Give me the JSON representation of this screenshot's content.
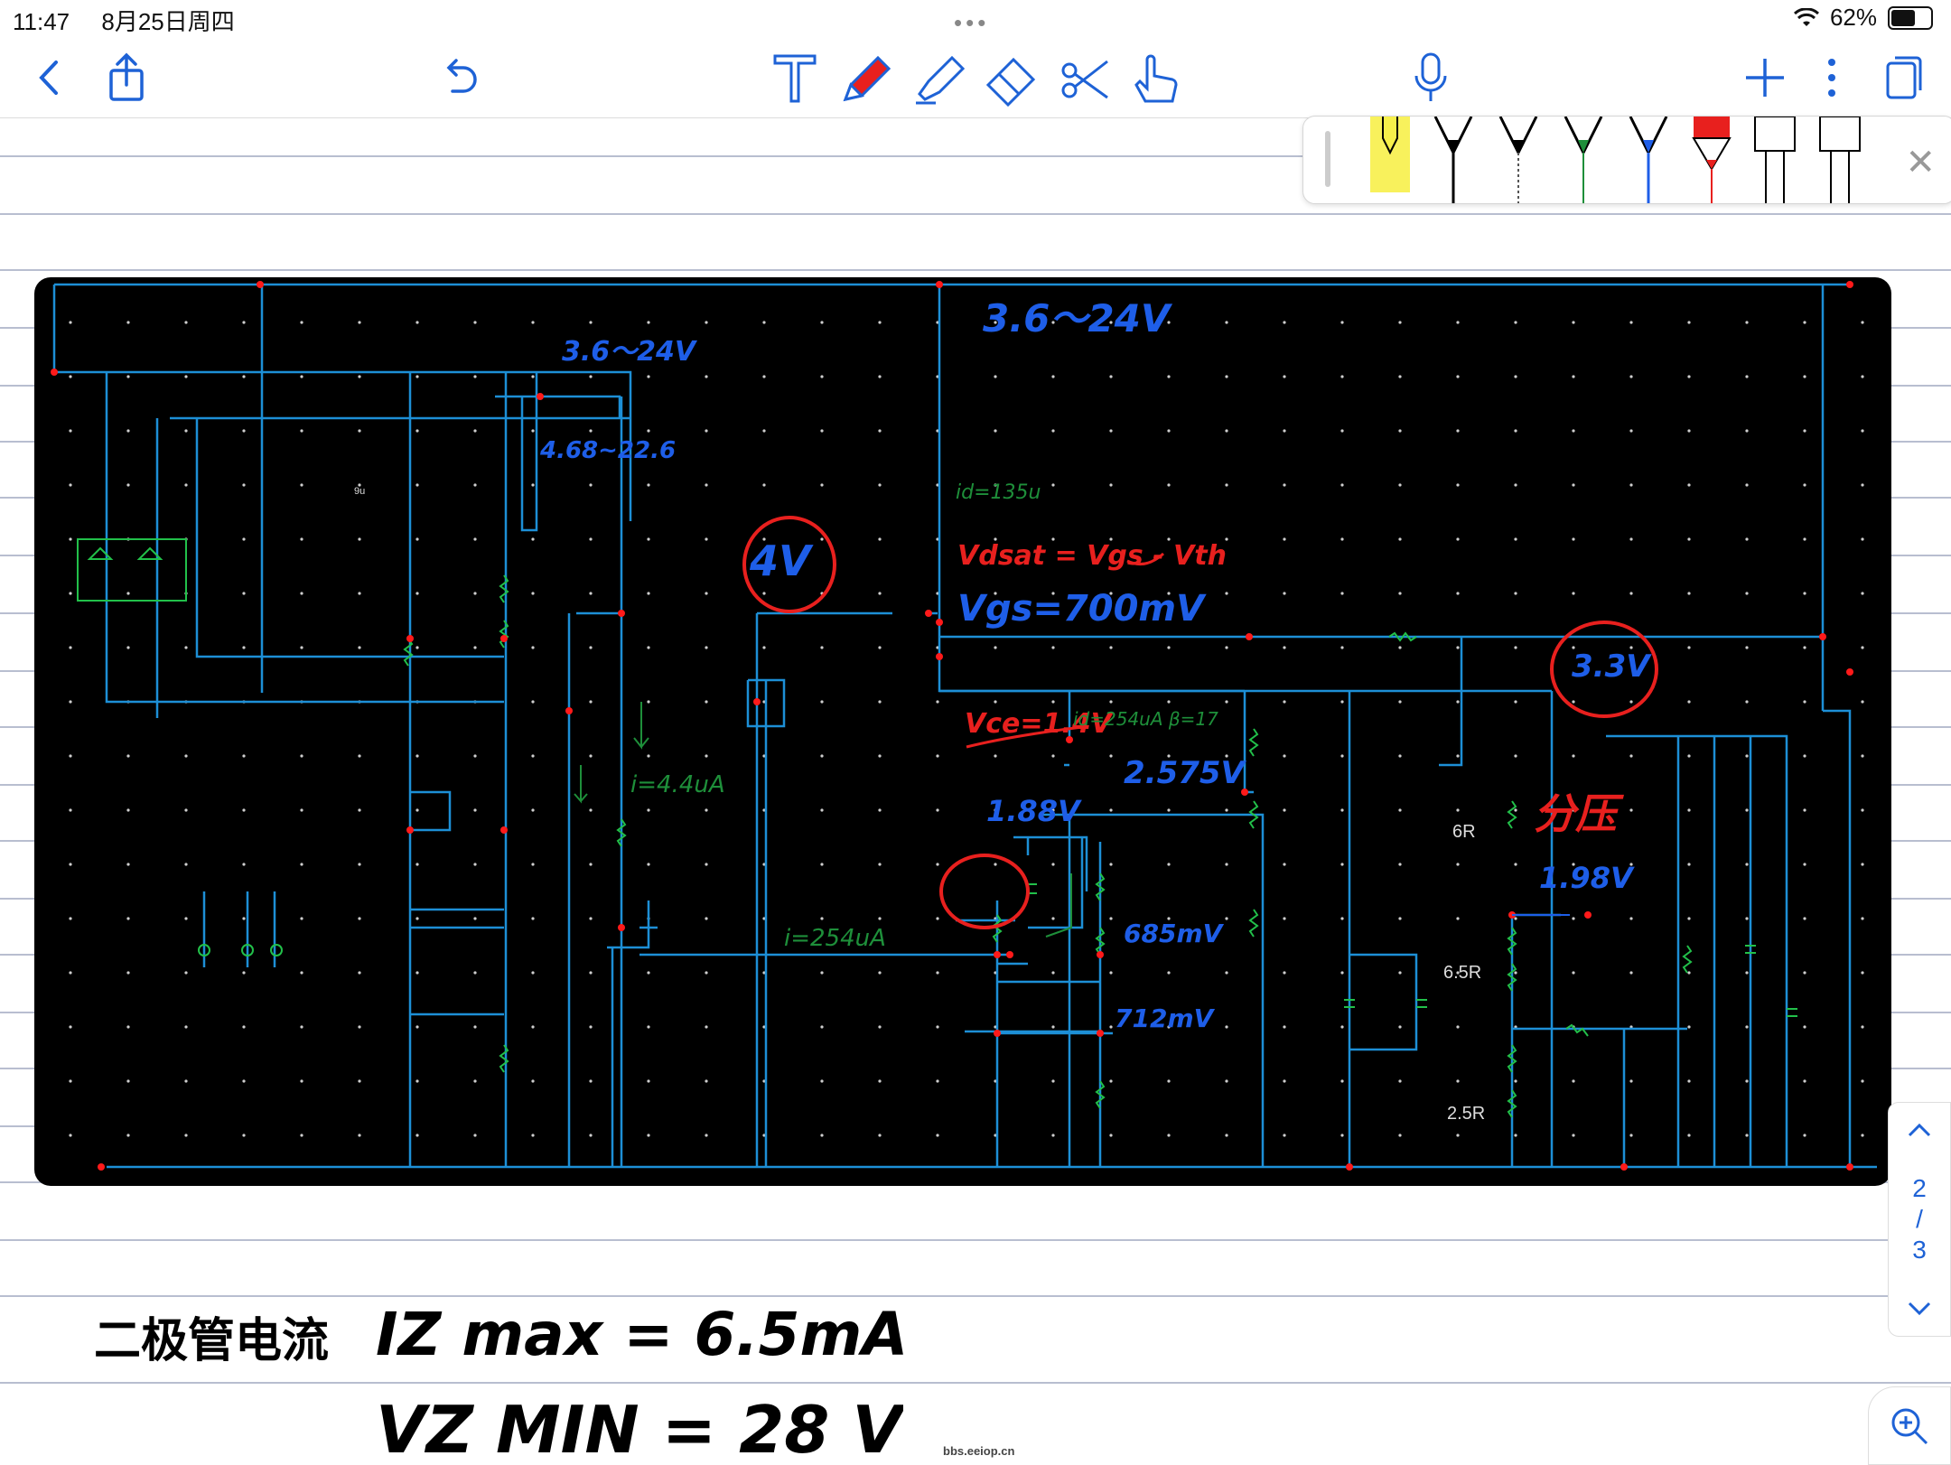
{
  "status": {
    "time": "11:47",
    "date": "8月25日周四",
    "dots": "•••",
    "battery": "62%"
  },
  "toolbar": {
    "icons": [
      "back-icon",
      "share-icon",
      "undo-icon",
      "text-tool-icon",
      "pen-tool-icon",
      "highlighter-tool-icon",
      "eraser-tool-icon",
      "lasso-tool-icon",
      "hand-tool-icon",
      "microphone-icon",
      "add-icon",
      "more-icon",
      "pages-icon"
    ]
  },
  "colors": {
    "accent": "#1e62d6",
    "wire": "#1d8fd6",
    "node": "#ff1a1a",
    "component": "#22c04a",
    "ink_blue": "#1e5ee8",
    "ink_red": "#e8201e",
    "ink_green": "#1e8f3a"
  },
  "circuit": {
    "supply_top": "3.6～24V",
    "supply_left": "3.6～24V",
    "node_range": "4.68~22.6",
    "gate_voltage": "4V",
    "id_note": "id=135u",
    "vdsat_eq": "Vdsat = Vgs - Vth",
    "vgs": "Vgs=700mV",
    "out_voltage": "3.3V",
    "vce": "Vce=1.4V",
    "ic_beta": "id=254uA β=17",
    "v_2575": "2.575V",
    "v_188": "1.88V",
    "v_685": "685mV",
    "v_712": "712mV",
    "v_198": "1.98V",
    "divider": "分压",
    "i_44": "i=4.4uA",
    "i_254": "i=254uA",
    "r6": "6R",
    "r65": "6.5R",
    "r25": "2.5R",
    "tiny_label": "9u"
  },
  "notes": {
    "line1_prefix": "二极管电流",
    "line1_eq": "IZ max = 6.5mA.",
    "line2_eq": "VZ MIN = 28 V"
  },
  "pager": {
    "current": "2",
    "sep": "/",
    "total": "3"
  },
  "watermark": "bbs.eeiop.cn"
}
